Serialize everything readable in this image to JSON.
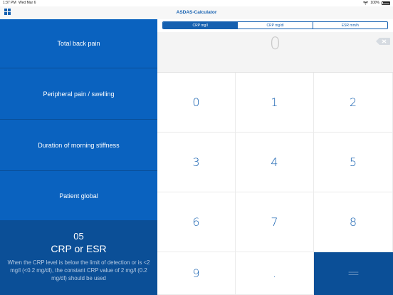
{
  "status_bar": {
    "time": "1:37 PM",
    "date": "Wed Mar 6",
    "battery": "100%"
  },
  "nav": {
    "title": "ASDAS-Calculator",
    "menu_icon": "grid-icon"
  },
  "sidebar": {
    "items": [
      {
        "label": "Total back pain"
      },
      {
        "label": "Peripheral pain / swelling"
      },
      {
        "label": "Duration of morning stiffness"
      },
      {
        "label": "Patient global"
      }
    ],
    "active": {
      "number": "05",
      "name": "CRP or ESR",
      "hint": "When the CRP level is below the limit of detection or is <2 mg/l (<0.2 mg/dl), the constant CRP value of 2 mg/l (0.2 mg/dl) should be used"
    }
  },
  "units": {
    "options": [
      "CRP mg/l",
      "CRP mg/dl",
      "ESR mm/h"
    ],
    "selected": "CRP mg/l"
  },
  "display": {
    "value": "0"
  },
  "keypad": {
    "keys": [
      "0",
      "1",
      "2",
      "3",
      "4",
      "5",
      "6",
      "7",
      "8",
      "9",
      ".",
      "="
    ]
  },
  "colors": {
    "primary": "#0a62bf",
    "dark_primary": "#0b4f97",
    "accent": "#1560b0"
  }
}
